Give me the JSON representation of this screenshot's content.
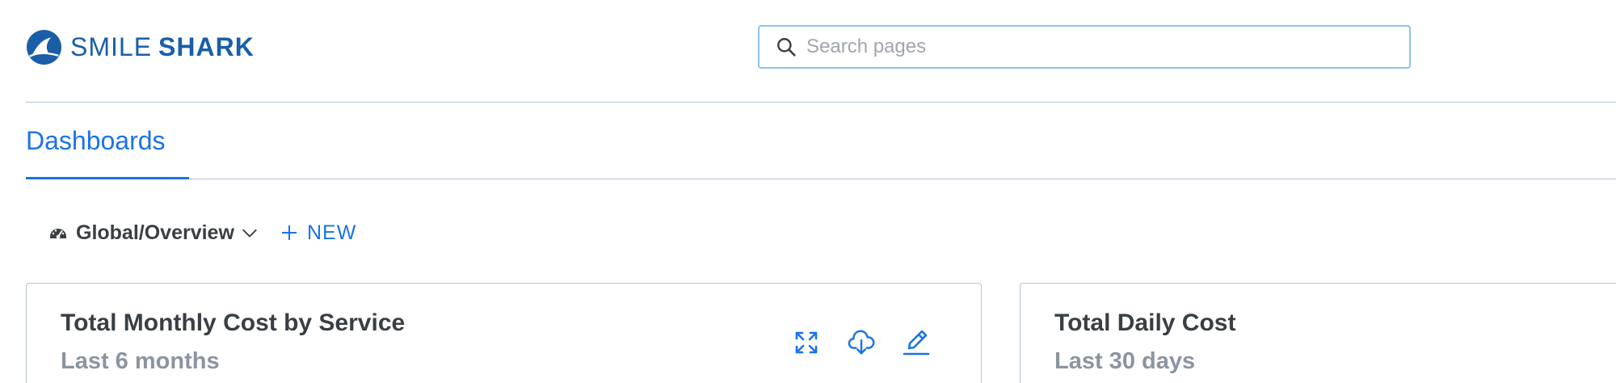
{
  "brand": {
    "name_light": "SMILE",
    "name_bold": "SHARK",
    "color": "#1a5ea8"
  },
  "search": {
    "placeholder": "Search pages",
    "value": ""
  },
  "tabs": [
    {
      "label": "Dashboards",
      "active": true
    }
  ],
  "dashboard_selector": {
    "label": "Global/Overview",
    "icon": "gauge-icon",
    "dropdown_icon": "chevron-down-icon"
  },
  "new_button": {
    "label": "NEW",
    "icon": "plus-icon"
  },
  "cards": [
    {
      "title": "Total Monthly Cost by Service",
      "subtitle": "Last 6 months",
      "actions": [
        "expand-icon",
        "cloud-download-icon",
        "edit-icon"
      ]
    },
    {
      "title": "Total Daily Cost",
      "subtitle": "Last 30 days"
    }
  ],
  "colors": {
    "accent": "#1a73e8",
    "border": "#b6c3d1",
    "heading": "#3a3f45",
    "muted": "#8b95a1"
  }
}
